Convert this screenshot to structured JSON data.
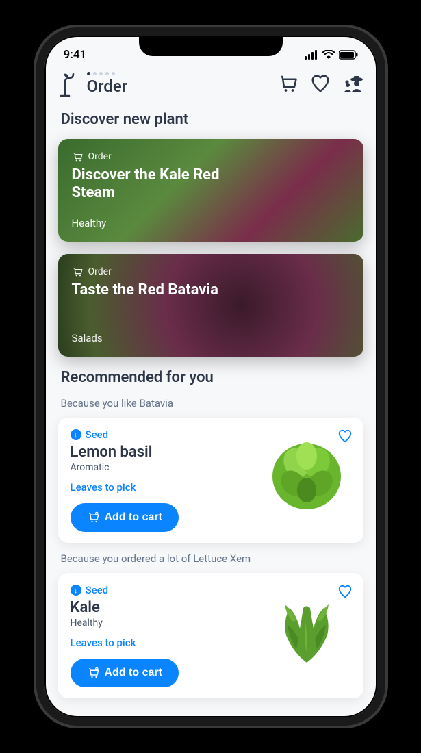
{
  "status": {
    "time": "9:41"
  },
  "header": {
    "title": "Order",
    "icons": {
      "cart": "cart-icon",
      "heart": "heart-icon",
      "profile": "farmer-icon"
    }
  },
  "discover": {
    "heading": "Discover new plant",
    "cards": [
      {
        "badge": "Order",
        "title": "Discover the Kale Red Steam",
        "tag": "Healthy"
      },
      {
        "badge": "Order",
        "title": "Taste the Red Batavia",
        "tag": "Salads"
      }
    ]
  },
  "recommended": {
    "heading": "Recommended for you",
    "groups": [
      {
        "reason": "Because you like Batavia",
        "item": {
          "badge": "Seed",
          "name": "Lemon basil",
          "category": "Aromatic",
          "status": "Leaves to pick",
          "cta": "Add to cart"
        }
      },
      {
        "reason": "Because you ordered a lot of Lettuce Xem",
        "item": {
          "badge": "Seed",
          "name": "Kale",
          "category": "Healthy",
          "status": "Leaves to pick",
          "cta": "Add to cart"
        }
      }
    ]
  },
  "colors": {
    "accent": "#0b84ff",
    "text": "#2d3748"
  }
}
